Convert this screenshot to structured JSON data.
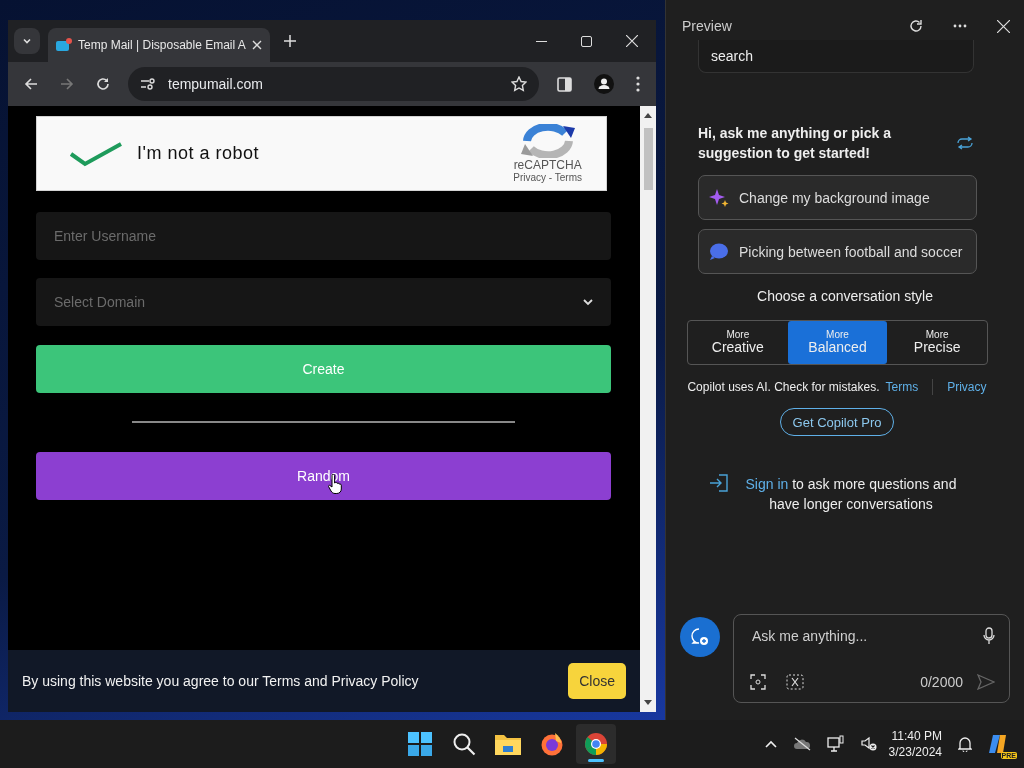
{
  "browser": {
    "tab": {
      "title": "Temp Mail | Disposable Email A"
    },
    "address": "tempumail.com",
    "captcha": {
      "label": "I'm not a robot",
      "checked": true,
      "brand": "reCAPTCHA",
      "links": "Privacy - Terms"
    },
    "username": {
      "placeholder": "Enter Username"
    },
    "domain": {
      "placeholder": "Select Domain"
    },
    "create_button": "Create",
    "random_button": "Random",
    "cookie_banner": {
      "text": "By using this website you agree to our Terms and Privacy Policy",
      "button": "Close"
    }
  },
  "copilot": {
    "title": "Preview",
    "search_value": "search",
    "greeting": "Hi, ask me anything or pick a suggestion to get started!",
    "suggestions": [
      {
        "text": "Change my background image",
        "kind": "sparkle"
      },
      {
        "text": "Picking between football and soccer",
        "kind": "chat"
      }
    ],
    "style_heading": "Choose a conversation style",
    "styles": [
      {
        "small": "More",
        "label": "Creative",
        "selected": false
      },
      {
        "small": "More",
        "label": "Balanced",
        "selected": true
      },
      {
        "small": "More",
        "label": "Precise",
        "selected": false
      }
    ],
    "disclaimer": "Copilot uses AI. Check for mistakes.",
    "terms": "Terms",
    "privacy": "Privacy",
    "pro_button": "Get Copilot Pro",
    "signin_link": "Sign in",
    "signin_text": "to ask more questions and have longer conversations",
    "input": {
      "placeholder": "Ask me anything...",
      "count": "0/2000"
    }
  },
  "taskbar": {
    "apps": [
      {
        "kind": "start",
        "selected": false
      },
      {
        "kind": "search",
        "selected": false
      },
      {
        "kind": "files",
        "selected": false
      },
      {
        "kind": "firefox",
        "selected": false
      },
      {
        "kind": "chrome",
        "selected": true
      }
    ],
    "time": "11:40 PM",
    "date": "3/23/2024",
    "copilot_badge": "PRE"
  }
}
